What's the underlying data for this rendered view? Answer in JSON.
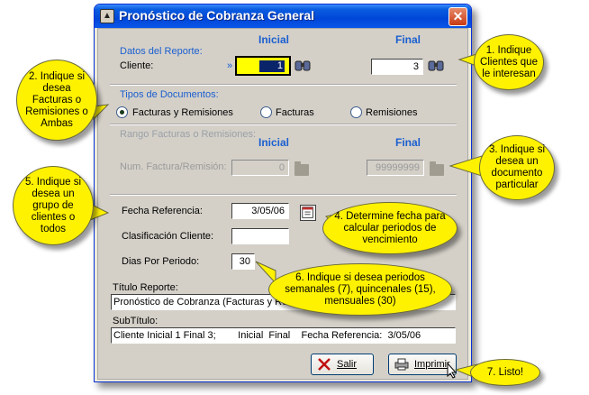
{
  "window": {
    "title": "Pronóstico de Cobranza General",
    "close_glyph": "✕"
  },
  "datos": {
    "section_label": "Datos del Reporte:",
    "col_inicial": "Inicial",
    "col_final": "Final",
    "cliente_label": "Cliente:",
    "arrow": "»",
    "cliente_inicial_value": "1",
    "cliente_final_value": "3"
  },
  "tipos": {
    "section_label": "Tipos de Documentos:",
    "options": [
      "Facturas y Remisiones",
      "Facturas",
      "Remisiones"
    ],
    "selected": "Facturas y Remisiones"
  },
  "rango": {
    "section_label": "Rango Facturas o Remisiones:",
    "col_inicial": "Inicial",
    "col_final": "Final",
    "num_label": "Num. Factura/Remisión:",
    "inicial_value": "0",
    "final_value": "99999999"
  },
  "params": {
    "fecha_label": "Fecha Referencia:",
    "fecha_value": "3/05/06",
    "clasif_label": "Clasificación Cliente:",
    "clasif_value": "",
    "dias_label": "Dias Por Periodo:",
    "dias_value": "30"
  },
  "titulo": {
    "label": "Título Reporte:",
    "value": "Pronóstico de Cobranza (Facturas y Re"
  },
  "subtitulo": {
    "label": "SubTítulo:",
    "value": "Cliente Inicial 1 Final 3;        Inicial  Final    Fecha Referencia:  3/05/06"
  },
  "buttons": {
    "salir": "Salir",
    "imprimir": "Imprimir"
  },
  "callouts": [
    "1. Indique Clientes que le interesan",
    "2. Indique si desea Facturas o Remisiones o Ambas",
    "3. Indique si desea un documento particular",
    "4. Determine fecha para calcular periodos de vencimiento",
    "5. Indique si desea un grupo de clientes o todos",
    "6. Indique si desea periodos semanales (7), quincenales (15), mensuales (30)",
    "7. Listo!"
  ],
  "colors": {
    "accent": "#1a5fd0",
    "highlight": "#ffff00",
    "callout": "#fff200",
    "titlebar": "#0047d9"
  }
}
